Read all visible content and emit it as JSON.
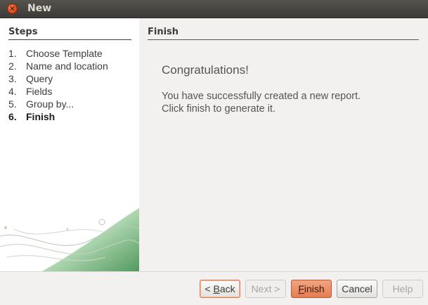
{
  "window": {
    "title": "New",
    "close_icon": "close-icon"
  },
  "steps": {
    "heading": "Steps",
    "items": [
      {
        "num": "1.",
        "label": "Choose Template"
      },
      {
        "num": "2.",
        "label": "Name and location"
      },
      {
        "num": "3.",
        "label": "Query"
      },
      {
        "num": "4.",
        "label": "Fields"
      },
      {
        "num": "5.",
        "label": "Group by..."
      },
      {
        "num": "6.",
        "label": "Finish"
      }
    ],
    "current_index": 5
  },
  "content": {
    "heading": "Finish",
    "congrats": "Congratulations!",
    "line1": "You have successfully created a new report.",
    "line2": "Click finish to generate it."
  },
  "buttons": {
    "back": {
      "prefix": "< ",
      "mnemonic": "B",
      "rest": "ack"
    },
    "next": "Next >",
    "finish": {
      "mnemonic": "F",
      "rest": "inish"
    },
    "cancel": "Cancel",
    "help": "Help"
  },
  "colors": {
    "title_bar": "#3c3b37",
    "close": "#df4a16",
    "finish_accent": "#e67c52",
    "decor_green": "#4c9a5a"
  }
}
